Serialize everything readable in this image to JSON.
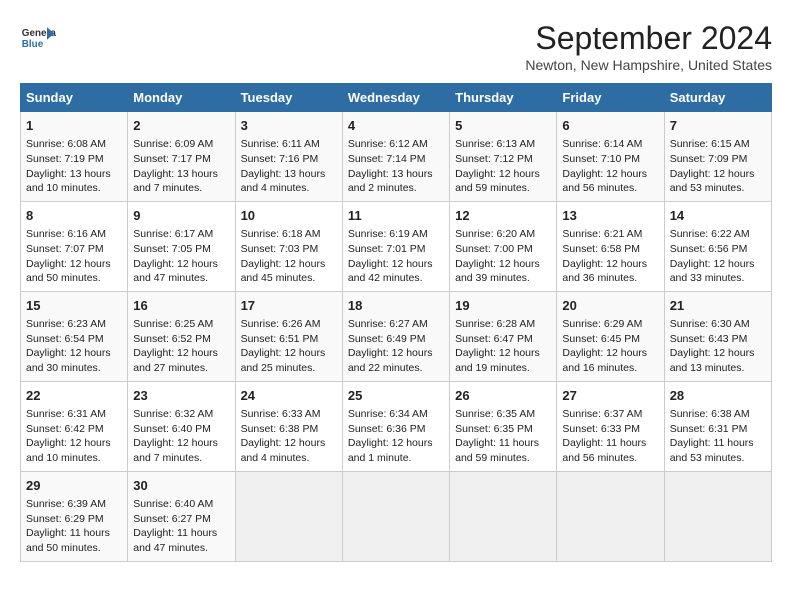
{
  "header": {
    "logo_line1": "General",
    "logo_line2": "Blue",
    "title": "September 2024",
    "subtitle": "Newton, New Hampshire, United States"
  },
  "days_of_week": [
    "Sunday",
    "Monday",
    "Tuesday",
    "Wednesday",
    "Thursday",
    "Friday",
    "Saturday"
  ],
  "weeks": [
    [
      {
        "day": "1",
        "sunrise": "6:08 AM",
        "sunset": "7:19 PM",
        "daylight": "13 hours and 10 minutes."
      },
      {
        "day": "2",
        "sunrise": "6:09 AM",
        "sunset": "7:17 PM",
        "daylight": "13 hours and 7 minutes."
      },
      {
        "day": "3",
        "sunrise": "6:11 AM",
        "sunset": "7:16 PM",
        "daylight": "13 hours and 4 minutes."
      },
      {
        "day": "4",
        "sunrise": "6:12 AM",
        "sunset": "7:14 PM",
        "daylight": "13 hours and 2 minutes."
      },
      {
        "day": "5",
        "sunrise": "6:13 AM",
        "sunset": "7:12 PM",
        "daylight": "12 hours and 59 minutes."
      },
      {
        "day": "6",
        "sunrise": "6:14 AM",
        "sunset": "7:10 PM",
        "daylight": "12 hours and 56 minutes."
      },
      {
        "day": "7",
        "sunrise": "6:15 AM",
        "sunset": "7:09 PM",
        "daylight": "12 hours and 53 minutes."
      }
    ],
    [
      {
        "day": "8",
        "sunrise": "6:16 AM",
        "sunset": "7:07 PM",
        "daylight": "12 hours and 50 minutes."
      },
      {
        "day": "9",
        "sunrise": "6:17 AM",
        "sunset": "7:05 PM",
        "daylight": "12 hours and 47 minutes."
      },
      {
        "day": "10",
        "sunrise": "6:18 AM",
        "sunset": "7:03 PM",
        "daylight": "12 hours and 45 minutes."
      },
      {
        "day": "11",
        "sunrise": "6:19 AM",
        "sunset": "7:01 PM",
        "daylight": "12 hours and 42 minutes."
      },
      {
        "day": "12",
        "sunrise": "6:20 AM",
        "sunset": "7:00 PM",
        "daylight": "12 hours and 39 minutes."
      },
      {
        "day": "13",
        "sunrise": "6:21 AM",
        "sunset": "6:58 PM",
        "daylight": "12 hours and 36 minutes."
      },
      {
        "day": "14",
        "sunrise": "6:22 AM",
        "sunset": "6:56 PM",
        "daylight": "12 hours and 33 minutes."
      }
    ],
    [
      {
        "day": "15",
        "sunrise": "6:23 AM",
        "sunset": "6:54 PM",
        "daylight": "12 hours and 30 minutes."
      },
      {
        "day": "16",
        "sunrise": "6:25 AM",
        "sunset": "6:52 PM",
        "daylight": "12 hours and 27 minutes."
      },
      {
        "day": "17",
        "sunrise": "6:26 AM",
        "sunset": "6:51 PM",
        "daylight": "12 hours and 25 minutes."
      },
      {
        "day": "18",
        "sunrise": "6:27 AM",
        "sunset": "6:49 PM",
        "daylight": "12 hours and 22 minutes."
      },
      {
        "day": "19",
        "sunrise": "6:28 AM",
        "sunset": "6:47 PM",
        "daylight": "12 hours and 19 minutes."
      },
      {
        "day": "20",
        "sunrise": "6:29 AM",
        "sunset": "6:45 PM",
        "daylight": "12 hours and 16 minutes."
      },
      {
        "day": "21",
        "sunrise": "6:30 AM",
        "sunset": "6:43 PM",
        "daylight": "12 hours and 13 minutes."
      }
    ],
    [
      {
        "day": "22",
        "sunrise": "6:31 AM",
        "sunset": "6:42 PM",
        "daylight": "12 hours and 10 minutes."
      },
      {
        "day": "23",
        "sunrise": "6:32 AM",
        "sunset": "6:40 PM",
        "daylight": "12 hours and 7 minutes."
      },
      {
        "day": "24",
        "sunrise": "6:33 AM",
        "sunset": "6:38 PM",
        "daylight": "12 hours and 4 minutes."
      },
      {
        "day": "25",
        "sunrise": "6:34 AM",
        "sunset": "6:36 PM",
        "daylight": "12 hours and 1 minute."
      },
      {
        "day": "26",
        "sunrise": "6:35 AM",
        "sunset": "6:35 PM",
        "daylight": "11 hours and 59 minutes."
      },
      {
        "day": "27",
        "sunrise": "6:37 AM",
        "sunset": "6:33 PM",
        "daylight": "11 hours and 56 minutes."
      },
      {
        "day": "28",
        "sunrise": "6:38 AM",
        "sunset": "6:31 PM",
        "daylight": "11 hours and 53 minutes."
      }
    ],
    [
      {
        "day": "29",
        "sunrise": "6:39 AM",
        "sunset": "6:29 PM",
        "daylight": "11 hours and 50 minutes."
      },
      {
        "day": "30",
        "sunrise": "6:40 AM",
        "sunset": "6:27 PM",
        "daylight": "11 hours and 47 minutes."
      },
      null,
      null,
      null,
      null,
      null
    ]
  ]
}
